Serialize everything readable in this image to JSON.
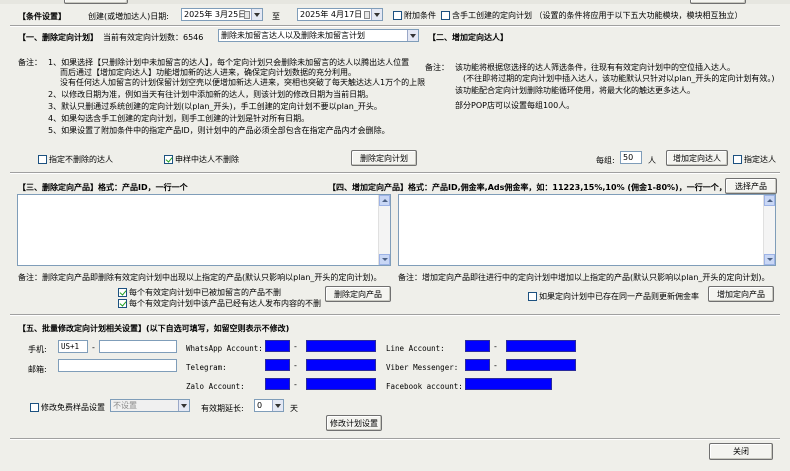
{
  "condition": {
    "title": "【条件设置】",
    "date_label": "创建(或増加达人)日期:",
    "date_from": "2025年 3月25日",
    "to_label": "至",
    "date_to": "2025年 4月17日",
    "extra_condition": "附加条件",
    "include_manual": "含手工创建的定向计划 （设置的条件将应用于以下五大功能模块，模块相互独立）"
  },
  "section1": {
    "title": "【一、删除定向计划】",
    "count_label": "当前有效定向计划数：6546",
    "mode_select": "删除未加留言达人以及删除未加留言计划",
    "note_label": "备注：",
    "notes": [
      "1、如果选择【只删除计划中未加留言的达人】，每个定向计划只会删除未加留言的达人以腾出达人位置",
      "而后通过【增加定向达人】功能增加新的达人进来，确保定向计划数据的充分利用。",
      "没有任何达人加留言的计划保留计划空壳以便增加新达人进来，突相也突破了每天触达达人1万个的上限",
      "2、以修改日期为准，例如当天有往计划中添加新的达人，则该计划的修改日期为当前日期。",
      "3、默认只删通过系统创建的定向计划(以plan_开头)，手工创建的定向计划不要以plan_开头。",
      "4、如果勾选含手工创建的定向计划，则手工创建的计划是针对所有日期。",
      "5、如果设置了附加条件中的指定产品ID，则计划中的产品必须全部包含在指定产品内才会删除。"
    ],
    "keep_specified": "指定不删除的达人",
    "keep_applying": "申样中达人不删除",
    "delete_button": "删除定向计划"
  },
  "section2": {
    "title": "【二、增加定向达人】",
    "note_label": "备注：",
    "notes": [
      "该功能将根据您选择的达人筛选条件，往现有有效定向计划中的空位插入达人。",
      "(不往即将过期的定向计划中插入达人，该功能默认只针对以plan_开头的定向计划有效。)",
      "该功能配合定向计划删除功能循环使用，将最大化的触达更多达人。",
      "部分POP店可以设置每组100人。"
    ],
    "per_group_label": "每组:",
    "per_group_value": "50",
    "unit": "人",
    "add_button": "增加定向达人",
    "specified_checkbox": "指定达人"
  },
  "section3": {
    "title": "【三、删除定向产品】格式：产品ID，一行一个",
    "note": "备注：删除定向产品即删除有效定向计划中出现以上指定的产品(默认只影响以plan_开头的定向计划)。",
    "opt1": "每个有效定向计划中已被加留言的产品不删",
    "opt2": "每个有效定向计划中该产品已经有达人发布内容的不删",
    "delete_button": "删除定向产品"
  },
  "section4": {
    "title": "【四、增加定向产品】格式：产品ID,佣金率,Ads佣金率，如：11223,15%,10% (佣金1-80%)，一行一个，最多100",
    "select_button": "选择产品",
    "note": "备注：增加定向产品即往进行中的定向计划中增加以上指定的产品(默认只影响以plan_开头的定向计划)。",
    "opt": "如果定向计划中已存在同一产品则更新佣金率",
    "add_button": "增加定向产品"
  },
  "section5": {
    "title": "【五、批量修改定向计划相关设置】(以下自选可填写，如留空则表示不修改)",
    "phone_label": "手机:",
    "phone_code": "US+1",
    "dash": "-",
    "email_label": "邮箱:",
    "whatsapp_label": "WhatsApp Account:",
    "telegram_label": "Telegram:",
    "zalo_label": "Zalo Account:",
    "line_label": "Line Account:",
    "viber_label": "Viber Messenger:",
    "facebook_label": "Facebook account:",
    "free_sample_label": "修改免费样品设置",
    "free_sample_value": "不设置",
    "validity_label": "有效期延长:",
    "validity_value": "0",
    "days": "天",
    "modify_button": "修改计划设置"
  },
  "close_button": "关闭"
}
